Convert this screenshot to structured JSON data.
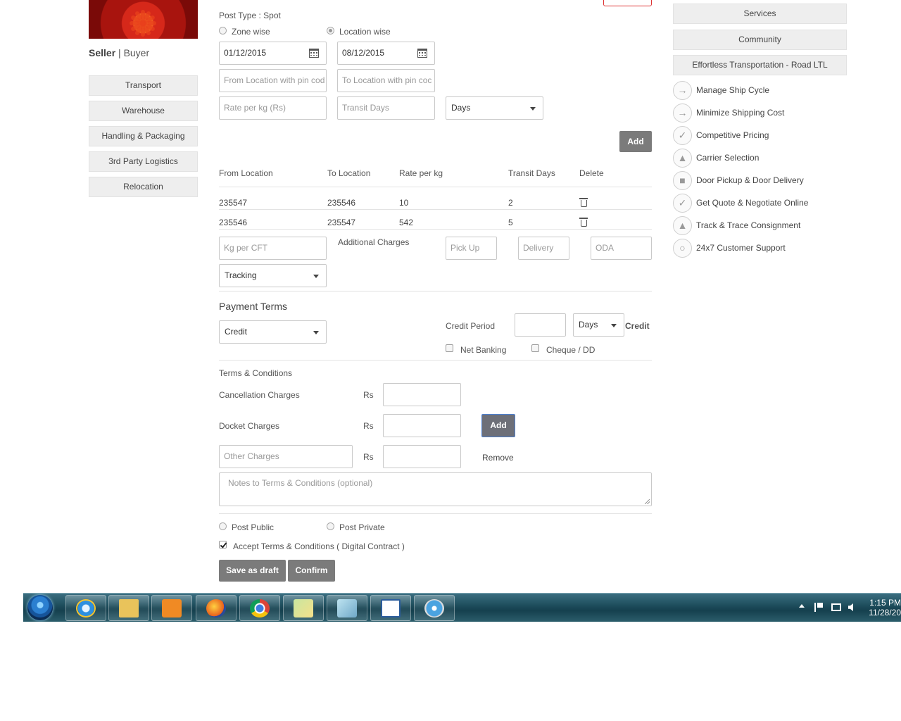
{
  "sidebar": {
    "role_seller": "Seller",
    "role_separator": "|",
    "role_buyer": "Buyer",
    "items": [
      {
        "label": "Transport"
      },
      {
        "label": "Warehouse"
      },
      {
        "label": "Handling & Packaging"
      },
      {
        "label": "3rd Party Logistics"
      },
      {
        "label": "Relocation"
      }
    ]
  },
  "form": {
    "post_type": "Post Type : Spot",
    "zone_wise": "Zone wise",
    "location_wise": "Location wise",
    "from_date": "01/12/2015",
    "to_date": "08/12/2015",
    "from_location_ph": "From Location with pin cod",
    "to_location_ph": "To Location with pin coc",
    "rate_ph": "Rate per kg (Rs)",
    "transit_ph": "Transit Days",
    "days_select": "Days",
    "add_label": "Add"
  },
  "rates_table": {
    "headers": [
      "From Location",
      "To Location",
      "Rate per kg",
      "Transit Days",
      "Delete"
    ],
    "rows": [
      {
        "from": "235547",
        "to": "235546",
        "rate": "10",
        "days": "2"
      },
      {
        "from": "235546",
        "to": "235547",
        "rate": "542",
        "days": "5"
      }
    ]
  },
  "charges": {
    "kg_per_cft_ph": "Kg per CFT",
    "additional_label": "Additional Charges",
    "pickup_ph": "Pick Up",
    "delivery_ph": "Delivery",
    "oda_ph": "ODA",
    "tracking_select": "Tracking"
  },
  "payment": {
    "title": "Payment Terms",
    "method_select": "Credit",
    "credit_period_label": "Credit Period",
    "credit_period_value": "",
    "period_unit": "Days",
    "credit_suffix": "Credit",
    "net_banking": "Net Banking",
    "cheque": "Cheque / DD"
  },
  "terms": {
    "title": "Terms & Conditions",
    "cancellation_label": "Cancellation Charges",
    "docket_label": "Docket Charges",
    "other_ph": "Other Charges",
    "currency": "Rs",
    "add_label": "Add",
    "remove_label": "Remove",
    "notes_ph": "Notes to Terms & Conditions (optional)"
  },
  "visibility": {
    "post_public": "Post Public",
    "post_private": "Post Private",
    "accept_terms": "Accept Terms & Conditions ( Digital Contract )",
    "accept_checked": true
  },
  "actions": {
    "save_draft": "Save as draft",
    "confirm": "Confirm"
  },
  "right_panel": {
    "buttons": [
      {
        "label": "Services"
      },
      {
        "label": "Community"
      },
      {
        "label": "Effortless Transportation - Road LTL"
      }
    ],
    "features": [
      {
        "label": "Manage Ship Cycle",
        "icon": "truck-icon"
      },
      {
        "label": "Minimize Shipping Cost",
        "icon": "truck-icon"
      },
      {
        "label": "Competitive Pricing",
        "icon": "check-icon"
      },
      {
        "label": "Carrier Selection",
        "icon": "tower-icon"
      },
      {
        "label": "Door Pickup & Door Delivery",
        "icon": "delivery-truck-icon"
      },
      {
        "label": "Get Quote & Negotiate Online",
        "icon": "check-icon"
      },
      {
        "label": "Track & Trace Consignment",
        "icon": "tower-icon"
      },
      {
        "label": "24x7 Customer Support",
        "icon": "headset-icon"
      }
    ]
  },
  "taskbar": {
    "time": "1:15 PM",
    "date": "11/28/20",
    "apps": [
      "internet-explorer-icon",
      "file-explorer-icon",
      "media-player-icon",
      "firefox-icon",
      "chrome-icon",
      "photos-icon",
      "paint-icon",
      "document-writer-icon",
      "safari-icon"
    ],
    "colors": {
      "accent": "#1f4f5e"
    }
  }
}
